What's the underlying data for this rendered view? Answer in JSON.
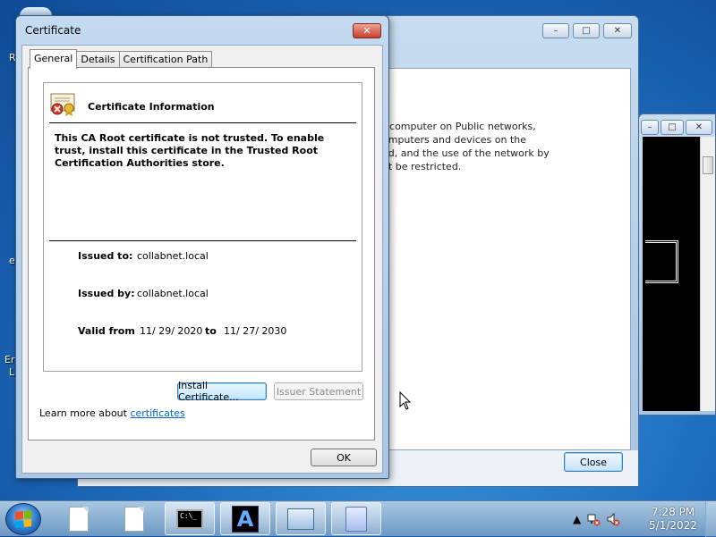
{
  "desktop": {
    "fragments": [
      "R",
      "e",
      "Er",
      "L"
    ]
  },
  "network_window": {
    "text_lines": [
      "r computer on Public networks,",
      "omputers and devices on the",
      "ed, and the use of the network by",
      "ht be restricted."
    ],
    "close_label": "Close",
    "min_glyph": "–",
    "max_glyph": "□",
    "x_glyph": "✕"
  },
  "console_window": {
    "min_glyph": "–",
    "max_glyph": "□",
    "x_glyph": "✕"
  },
  "certificate": {
    "title": "Certificate",
    "close_glyph": "✕",
    "tabs": [
      {
        "label": "General",
        "active": true
      },
      {
        "label": "Details",
        "active": false
      },
      {
        "label": "Certification Path",
        "active": false
      }
    ],
    "info_title": "Certificate Information",
    "warning": "This CA Root certificate is not trusted. To enable trust, install this certificate in the Trusted Root Certification Authorities store.",
    "issued_to_label": "Issued to:",
    "issued_to": "collabnet.local",
    "issued_by_label": "Issued by:",
    "issued_by": "collabnet.local",
    "valid_from_label": "Valid from",
    "valid_from": "11/ 29/ 2020",
    "to_label": "to",
    "valid_to": "11/ 27/ 2030",
    "install_button": "Install Certificate...",
    "issuer_button": "Issuer Statement",
    "learn_prefix": "Learn more about ",
    "learn_link": "certificates",
    "ok_button": "OK"
  },
  "taskbar": {
    "cmd_text": "C:\\_",
    "a_letter": "A",
    "time": "7:28 PM",
    "date": "5/1/2022",
    "tray_arrow": "▲"
  }
}
